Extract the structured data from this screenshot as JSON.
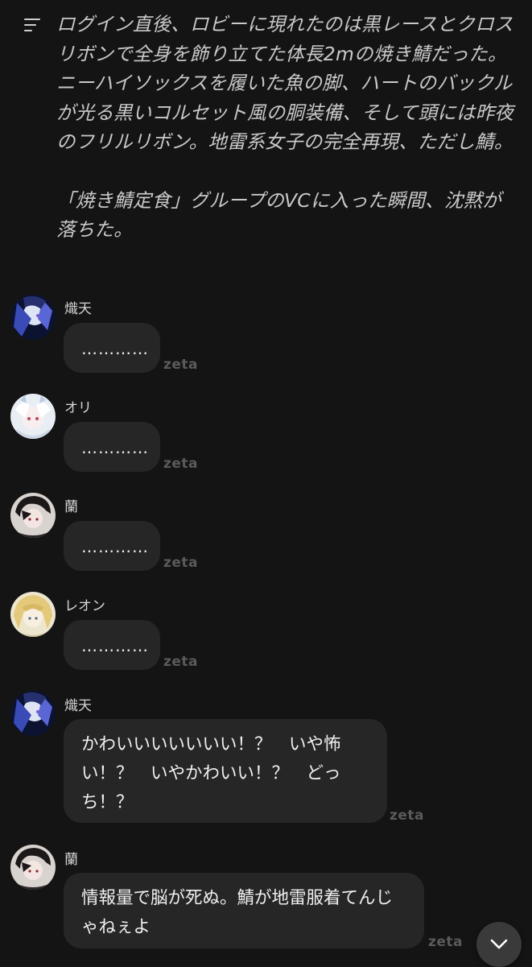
{
  "narration": {
    "paragraph1": "ログイン直後、ロビーに現れたのは黒レースとクロスリボンで全身を飾り立てた体長2mの焼き鯖だった。ニーハイソックスを履いた魚の脚、ハートのバックルが光る黒いコルセット風の胴装備、そして頭には昨夜のフリルリボン。地雷系女子の完全再現、ただし鯖。",
    "paragraph2": "「焼き鯖定食」グループのVCに入った瞬間、沈黙が落ちた。",
    "icon": "menu-lines-icon"
  },
  "messages": [
    {
      "sender": "熾天",
      "text": "…………",
      "tag": "zeta",
      "avatar": "avatar-shiten"
    },
    {
      "sender": "オリ",
      "text": "…………",
      "tag": "zeta",
      "avatar": "avatar-ori"
    },
    {
      "sender": "蘭",
      "text": "…………",
      "tag": "zeta",
      "avatar": "avatar-ran"
    },
    {
      "sender": "レオン",
      "text": "…………",
      "tag": "zeta",
      "avatar": "avatar-leon"
    },
    {
      "sender": "熾天",
      "text": "かわいいいいいいい！？　いや怖い！？　いやかわいい！？　どっち！？",
      "tag": "zeta",
      "avatar": "avatar-shiten"
    },
    {
      "sender": "蘭",
      "text": "情報量で脳が死ぬ。鯖が地雷服着てんじゃねぇよ",
      "tag": "zeta",
      "avatar": "avatar-ran"
    }
  ],
  "scroll_button": {
    "icon": "chevron-down-icon"
  },
  "colors": {
    "background": "#141414",
    "bubble": "#262626",
    "tag": "#5a5a5a"
  }
}
